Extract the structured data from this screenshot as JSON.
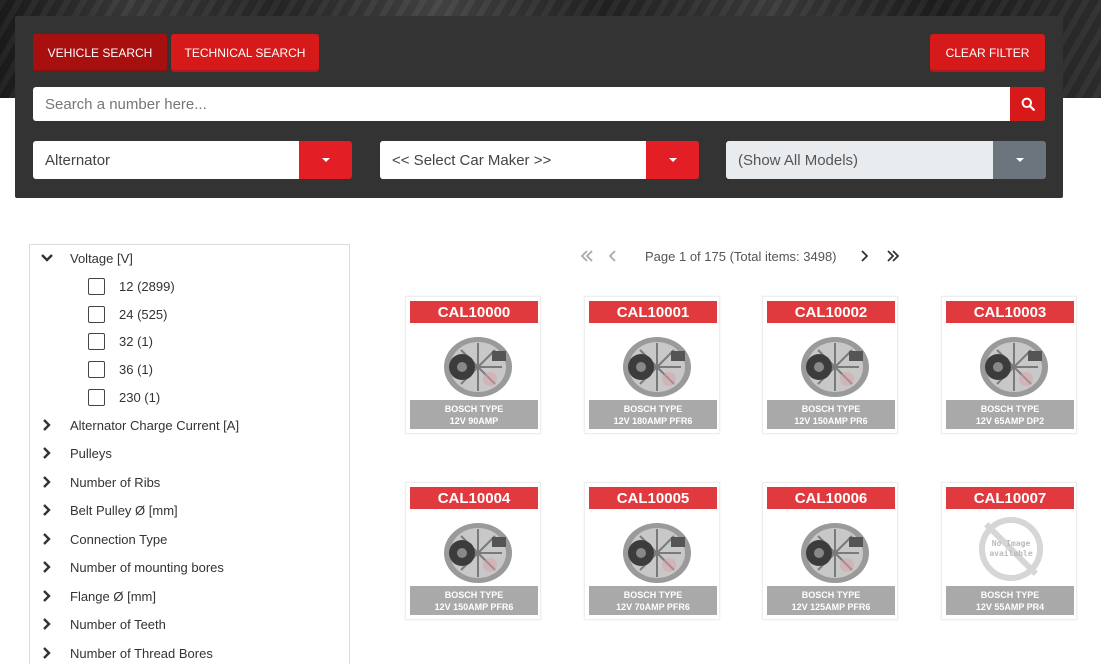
{
  "header": {
    "vehicle_search_label": "VEHICLE SEARCH",
    "technical_search_label": "TECHNICAL SEARCH",
    "clear_filter_label": "CLEAR FILTER",
    "search_placeholder": "Search a number here...",
    "search_icon": "search-icon"
  },
  "selects": {
    "category": "Alternator",
    "car_maker": "<< Select Car Maker >>",
    "model": "(Show All Models)"
  },
  "filters": {
    "voltage": {
      "label": "Voltage [V]",
      "options": [
        "12 (2899)",
        "24 (525)",
        "32 (1)",
        "36 (1)",
        "230 (1)"
      ]
    },
    "collapsed": [
      "Alternator Charge Current [A]",
      "Pulleys",
      "Number of Ribs",
      "Belt Pulley Ø [mm]",
      "Connection Type",
      "Number of mounting bores",
      "Flange Ø [mm]",
      "Number of Teeth",
      "Number of Thread Bores"
    ]
  },
  "pager": {
    "text": "Page 1 of 175 (Total items: 3498)"
  },
  "products": [
    {
      "code": "CAL10000",
      "line1": "BOSCH TYPE",
      "line2": "12V 90AMP",
      "has_image": true
    },
    {
      "code": "CAL10001",
      "line1": "BOSCH TYPE",
      "line2": "12V 180AMP PFR6",
      "has_image": true
    },
    {
      "code": "CAL10002",
      "line1": "BOSCH TYPE",
      "line2": "12V 150AMP PR6",
      "has_image": true
    },
    {
      "code": "CAL10003",
      "line1": "BOSCH TYPE",
      "line2": "12V 65AMP DP2",
      "has_image": true
    },
    {
      "code": "CAL10004",
      "line1": "BOSCH TYPE",
      "line2": "12V 150AMP PFR6",
      "has_image": true
    },
    {
      "code": "CAL10005",
      "line1": "BOSCH TYPE",
      "line2": "12V 70AMP PFR6",
      "has_image": true
    },
    {
      "code": "CAL10006",
      "line1": "BOSCH TYPE",
      "line2": "12V 125AMP PFR6",
      "has_image": true
    },
    {
      "code": "CAL10007",
      "line1": "BOSCH TYPE",
      "line2": "12V 55AMP PR4",
      "has_image": false,
      "no_image_text": "No Image available"
    }
  ],
  "colors": {
    "accent": "#d61a1a",
    "panel": "#333333",
    "code_banner": "#e03a3e"
  }
}
